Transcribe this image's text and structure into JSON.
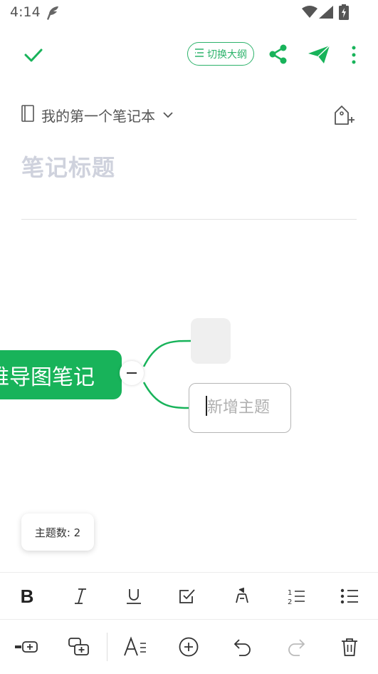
{
  "status_bar": {
    "time": "4:14"
  },
  "toolbar": {
    "outline_label": "切换大纲"
  },
  "notebook": {
    "name": "我的第一个笔记本"
  },
  "note": {
    "title_placeholder": "笔记标题"
  },
  "mindmap": {
    "root_label": "思维导图笔记",
    "children": [
      {
        "label": ""
      },
      {
        "label": "新增主题"
      }
    ]
  },
  "topic_count": {
    "label": "主题数: 2"
  },
  "colors": {
    "accent": "#18b35a",
    "accent_light": "#2db36b",
    "placeholder": "#cfd2dd"
  },
  "format_bar": {
    "bold": "B",
    "items": [
      "bold-icon",
      "italic-icon",
      "underline-icon",
      "checkbox-icon",
      "highlighter-icon",
      "numbered-list-icon",
      "bullet-list-icon"
    ]
  },
  "action_bar": {
    "items": [
      "add-sibling-icon",
      "add-child-icon",
      "text-style-icon",
      "add-circle-icon",
      "undo-icon",
      "redo-icon",
      "trash-icon"
    ]
  }
}
